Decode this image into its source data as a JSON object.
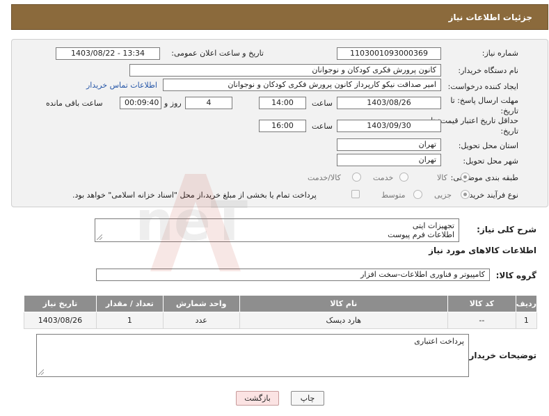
{
  "header": {
    "title": "جزئیات اطلاعات نیاز"
  },
  "form": {
    "need_number_label": "شماره نیاز:",
    "need_number": "1103001093000369",
    "announce_label": "تاریخ و ساعت اعلان عمومی:",
    "announce_value": "1403/08/22 - 13:34",
    "buyer_org_label": "نام دستگاه خریدار:",
    "buyer_org": "کانون پرورش فکری کودکان و نوجوانان",
    "requester_label": "ایجاد کننده درخواست:",
    "requester": "امیر صداقت نیکو کارپرداز کانون پرورش فکری کودکان و نوجوانان",
    "contact_link": "اطلاعات تماس خریدار",
    "reply_deadline_label": "مهلت ارسال پاسخ: تا تاریخ:",
    "reply_date": "1403/08/26",
    "time_label": "ساعت",
    "reply_time": "14:00",
    "days_value": "4",
    "days_label": "روز و",
    "remaining_time": "00:09:40",
    "remaining_label": "ساعت باقی مانده",
    "price_validity_label": "حداقل تاریخ اعتبار قیمت: تا تاریخ:",
    "price_date": "1403/09/30",
    "price_time": "16:00",
    "province_label": "استان محل تحویل:",
    "province": "تهران",
    "city_label": "شهر محل تحویل:",
    "city": "تهران",
    "category_label": "طبقه بندی موضوعی:",
    "category_options": [
      "کالا",
      "خدمت",
      "کالا/خدمت"
    ],
    "process_label": "نوع فرآیند خرید :",
    "process_options": [
      "جزیی",
      "متوسط"
    ],
    "payment_note": "پرداخت تمام یا بخشی از مبلغ خرید،از محل \"اسناد خزانه اسلامی\" خواهد بود."
  },
  "summary": {
    "label": "شرح کلی نیاز:",
    "lines": [
      "تجهیزات ایتی",
      "اطلاعات فرم پیوست"
    ]
  },
  "goods": {
    "section_title": "اطلاعات کالاهای مورد نیاز",
    "group_label": "گروه کالا:",
    "group_value": "کامپیوتر و فناوری اطلاعات-سخت افزار",
    "columns": [
      "ردیف",
      "کد کالا",
      "نام کالا",
      "واحد شمارش",
      "تعداد / مقدار",
      "تاریخ نیاز"
    ],
    "rows": [
      {
        "row": "1",
        "code": "--",
        "name": "هارد دیسک",
        "unit": "عدد",
        "qty": "1",
        "date": "1403/08/26"
      }
    ]
  },
  "buyer_notes": {
    "label": "توضیحات خریدار:",
    "text": "پرداخت اعتباری"
  },
  "buttons": {
    "print": "چاپ",
    "back": "بازگشت"
  },
  "watermark": {
    "text": "AriaTender.neT"
  },
  "colors": {
    "header_bg": "#8b6a3c",
    "panel_bg": "#f2f2f2",
    "table_header_bg": "#8e8e8e",
    "link": "#2757a8"
  }
}
